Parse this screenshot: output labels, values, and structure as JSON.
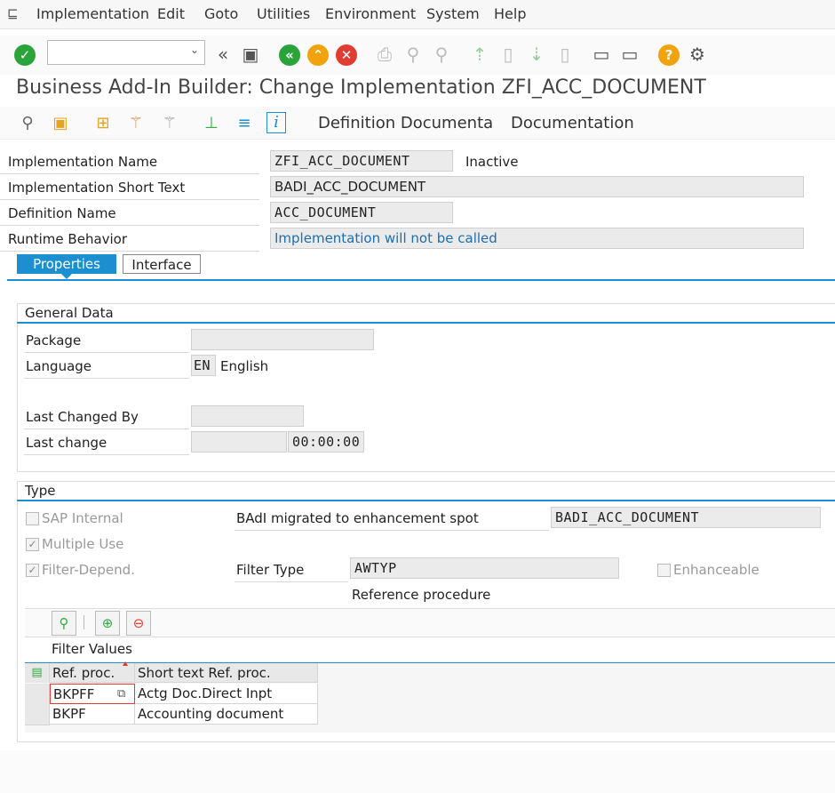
{
  "menubar": {
    "icon": "menu-icon",
    "items": [
      "Implementation",
      "Edit",
      "Goto",
      "Utilities",
      "Environment",
      "System",
      "Help"
    ]
  },
  "toolbar": {
    "command_value": "",
    "icons": [
      "enter-icon",
      "back-double-icon",
      "save-icon",
      "back-icon",
      "exit-icon",
      "cancel-icon",
      "print-icon",
      "find-icon",
      "find-next-icon",
      "first-page-icon",
      "previous-page-icon",
      "next-page-icon",
      "last-page-icon",
      "create-session-icon",
      "shortcut-icon",
      "help-icon",
      "customize-icon"
    ]
  },
  "title": "Business Add-In Builder: Change Implementation ZFI_ACC_DOCUMENT",
  "app_toolbar": {
    "icons": [
      "display-object-list-icon",
      "other-object-icon",
      "tree-icon",
      "activate-icon",
      "deactivate-icon",
      "hierarchy-icon",
      "align-icon",
      "info-icon"
    ],
    "definition_doc": "Definition Documenta",
    "documentation": "Documentation"
  },
  "header": {
    "impl_name_label": "Implementation Name",
    "impl_name": "ZFI_ACC_DOCUMENT",
    "status": "Inactive",
    "short_text_label": "Implementation Short Text",
    "short_text": "BADI_ACC_DOCUMENT",
    "def_name_label": "Definition Name",
    "def_name": "ACC_DOCUMENT",
    "runtime_label": "Runtime Behavior",
    "runtime": "Implementation will not be called"
  },
  "tabs": [
    {
      "label": "Properties",
      "active": true
    },
    {
      "label": "Interface",
      "active": false
    }
  ],
  "general": {
    "title": "General Data",
    "package_label": "Package",
    "package": "",
    "language_label": "Language",
    "language_code": "EN",
    "language_name": "English",
    "changed_by_label": "Last Changed By",
    "changed_by": "",
    "last_change_label": "Last change",
    "last_change_date": "",
    "last_change_time": "00:00:00"
  },
  "type": {
    "title": "Type",
    "sap_internal": "SAP Internal",
    "multiple_use": "Multiple Use",
    "filter_depend": "Filter-Depend.",
    "migrated_label": "BAdI migrated to enhancement spot",
    "migrated_value": "BADI_ACC_DOCUMENT",
    "filter_type_label": "Filter Type",
    "filter_type": "AWTYP",
    "enhanceable": "Enhanceable",
    "ref_proc_label": "Reference procedure"
  },
  "filter_table": {
    "title": "Filter Values",
    "columns": [
      "Ref. proc.",
      "Short text Ref. proc."
    ],
    "rows": [
      [
        "BKPFF",
        "Actg Doc.Direct Inpt"
      ],
      [
        "BKPF",
        "Accounting document"
      ]
    ]
  },
  "colors": {
    "accent": "#1b8fd0",
    "enter_green": "#2aa33a",
    "cancel_red": "#e03c31",
    "help_orange": "#f0a30a"
  }
}
